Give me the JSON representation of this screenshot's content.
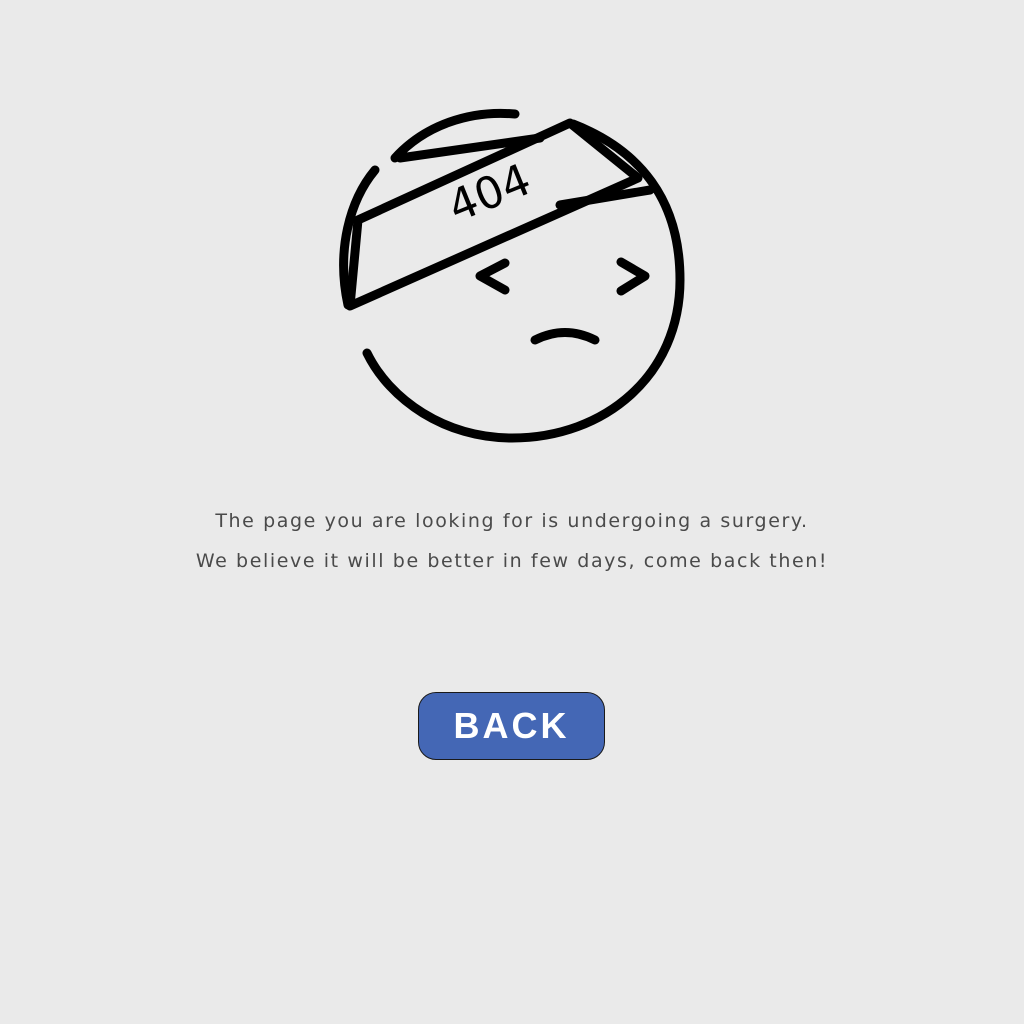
{
  "illustration": {
    "icon": "bandaged-sad-face-icon",
    "bandage_text": "404",
    "stroke_color": "#000000"
  },
  "message": {
    "line1": "The page you are looking for is undergoing a surgery.",
    "line2": "We believe it will be better in few days, come back then!"
  },
  "back_button": {
    "label": "BACK",
    "color": "#4467b5"
  },
  "colors": {
    "background": "#eaeaea",
    "text": "#4a4a4a"
  }
}
